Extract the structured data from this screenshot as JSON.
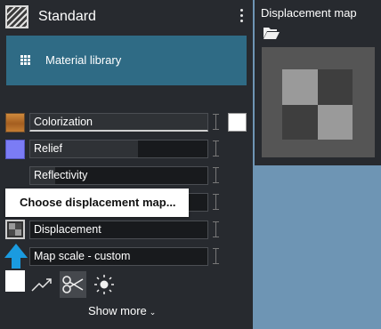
{
  "material": {
    "name": "Standard"
  },
  "library_button": {
    "label": "Material library"
  },
  "channels": [
    {
      "label": "Colorization",
      "fill": 1.0
    },
    {
      "label": "Relief",
      "fill": 0.61
    },
    {
      "label": "Reflectivity",
      "fill": 0.14
    },
    {
      "label": ""
    },
    {
      "label": "Displacement",
      "fill": 0.0
    },
    {
      "label": "Map scale - custom",
      "fill": 0.0
    }
  ],
  "tooltip": {
    "text": "Choose displacement map..."
  },
  "show_more": {
    "label": "Show more"
  },
  "preview": {
    "title": "Displacement map"
  },
  "colors": {
    "accent": "#2f6b85",
    "panel": "#272a2f",
    "background": "#6e95b4",
    "arrow": "#1a9be0"
  },
  "icons": [
    "hatched-swatch-icon",
    "kebab-menu-icon",
    "grid-icon",
    "wood-swatch-icon",
    "relief-swatch-icon",
    "checker-swatch-icon",
    "up-arrow-icon",
    "curve-icon",
    "scissors-icon",
    "sun-icon",
    "chevron-down-icon",
    "folder-open-icon"
  ]
}
